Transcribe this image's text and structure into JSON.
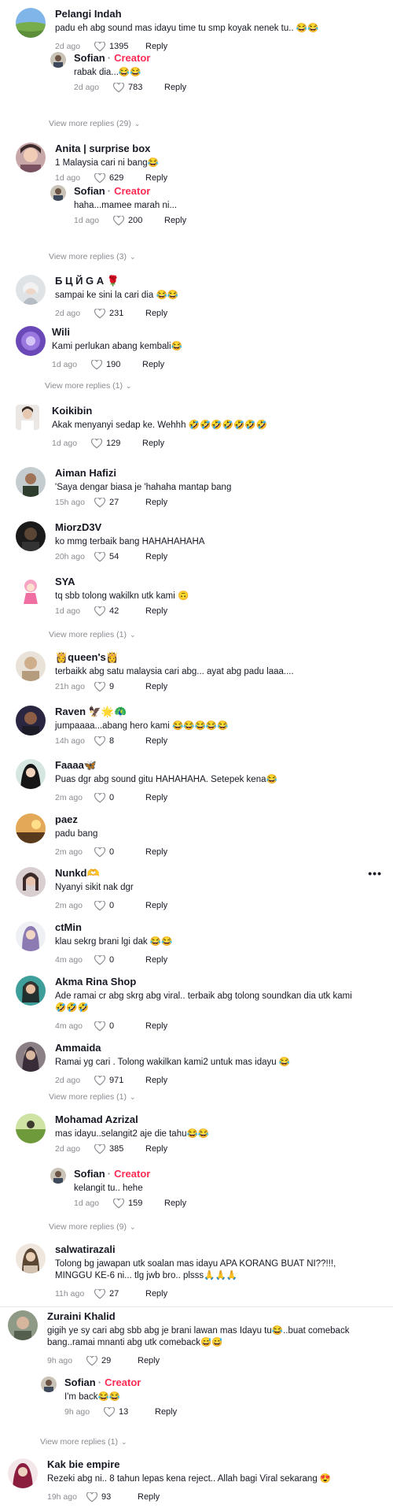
{
  "comments": [
    {
      "name": "Pelangi Indah",
      "text": "padu eh abg sound mas idayu time tu smp koyak nenek tu.. 😂😂",
      "time": "2d ago",
      "likes": "1395",
      "reply": "Reply"
    },
    {
      "name": "Sofian",
      "creator": "Creator",
      "text": "rabak dia...😂😂",
      "time": "2d ago",
      "likes": "783",
      "reply": "Reply"
    },
    {
      "more": "View more replies (29)"
    },
    {
      "name": "Anita | surprise box",
      "text": "1 Malaysia cari ni bang😂",
      "time": "1d ago",
      "likes": "629",
      "reply": "Reply"
    },
    {
      "name": "Sofian",
      "creator": "Creator",
      "text": "haha...mamee marah ni...",
      "time": "1d ago",
      "likes": "200",
      "reply": "Reply"
    },
    {
      "more": "View more replies (3)"
    },
    {
      "name": "Б Ц Й G А 🌹",
      "text": "sampai ke sini la cari dia 😂😂",
      "time": "2d ago",
      "likes": "231",
      "reply": "Reply"
    },
    {
      "name": "Wili",
      "text": "Kami perlukan abang kembali😂",
      "time": "1d ago",
      "likes": "190",
      "reply": "Reply"
    },
    {
      "more": "View more replies (1)"
    },
    {
      "name": "Koikibin",
      "text": "Akak menyanyi sedap ke. Wehhh 🤣🤣🤣🤣🤣🤣🤣",
      "time": "1d ago",
      "likes": "129",
      "reply": "Reply"
    },
    {
      "name": "Aiman Hafizi",
      "text": "'Saya dengar biasa je 'hahaha mantap bang",
      "time": "15h ago",
      "likes": "27",
      "reply": "Reply"
    },
    {
      "name": "MiorzD3V",
      "text": "ko mmg terbaik bang HAHAHAHAHA",
      "time": "20h ago",
      "likes": "54",
      "reply": "Reply"
    },
    {
      "name": "SYA",
      "text": "tq sbb tolong wakilkn utk kami 🙃",
      "time": "1d ago",
      "likes": "42",
      "reply": "Reply"
    },
    {
      "more": "View more replies (1)"
    },
    {
      "name": "👸queen's👸",
      "text": "terbaikk abg satu malaysia cari abg... ayat abg padu laaa....",
      "time": "21h ago",
      "likes": "9",
      "reply": "Reply"
    },
    {
      "name": "Raven 🦅🌟🦚",
      "text": "jumpaaaa...abang hero kami 😂😂😂😂😂",
      "time": "14h ago",
      "likes": "8",
      "reply": "Reply"
    },
    {
      "name": "Faaaa🦋",
      "text": "Puas dgr abg sound gitu HAHAHAHA. Setepek kena😂",
      "time": "2m ago",
      "likes": "0",
      "reply": "Reply"
    },
    {
      "name": "paez",
      "text": "padu bang",
      "time": "2m ago",
      "likes": "0",
      "reply": "Reply"
    },
    {
      "name": "Nunkd🫶",
      "text": "Nyanyi sikit nak dgr",
      "time": "2m ago",
      "likes": "0",
      "reply": "Reply",
      "menu": "•••"
    },
    {
      "name": "ctMin",
      "text": "klau sekrg brani lgi dak 😂😂",
      "time": "4m ago",
      "likes": "0",
      "reply": "Reply"
    },
    {
      "name": "Akma Rina Shop",
      "text": "Ade ramai cr abg skrg abg viral.. terbaik abg tolong soundkan dia utk kami 🤣🤣🤣",
      "time": "4m ago",
      "likes": "0",
      "reply": "Reply"
    },
    {
      "name": "Ammaida",
      "text": "Ramai yg cari . Tolong wakilkan kami2 untuk mas idayu 😂",
      "time": "2d ago",
      "likes": "971",
      "reply": "Reply"
    },
    {
      "more": "View more replies (1)"
    },
    {
      "name": "Mohamad Azrizal",
      "text": "mas idayu..selangit2 aje die tahu😂😂",
      "time": "2d ago",
      "likes": "385",
      "reply": "Reply"
    },
    {
      "name": "Sofian",
      "creator": "Creator",
      "text": "kelangit tu.. hehe",
      "time": "1d ago",
      "likes": "159",
      "reply": "Reply"
    },
    {
      "more": "View more replies (9)"
    },
    {
      "name": "salwatirazali",
      "text": "Tolong bg jawapan utk soalan mas idayu APA KORANG BUAT NI??!!!, MINGGU KE-6 ni... tlg jwb bro.. plsss🙏🙏🙏",
      "time": "11h ago",
      "likes": "27",
      "reply": "Reply"
    },
    {
      "name": "Zuraini Khalid",
      "text": "gigih ye sy cari abg sbb abg je brani lawan mas Idayu tu😂..buat comeback bang..ramai mnanti abg utk comeback😅😅",
      "time": "9h ago",
      "likes": "29",
      "reply": "Reply"
    },
    {
      "name": "Sofian",
      "creator": "Creator",
      "text": "I'm back😂😂",
      "time": "9h ago",
      "likes": "13",
      "reply": "Reply"
    },
    {
      "more": "View more replies (1)"
    },
    {
      "name": "Kak bie empire",
      "text": "Rezeki abg ni.. 8 tahun lepas kena reject.. Allah bagi Viral sekarang 😍",
      "time": "19h ago",
      "likes": "93",
      "reply": "Reply"
    }
  ]
}
